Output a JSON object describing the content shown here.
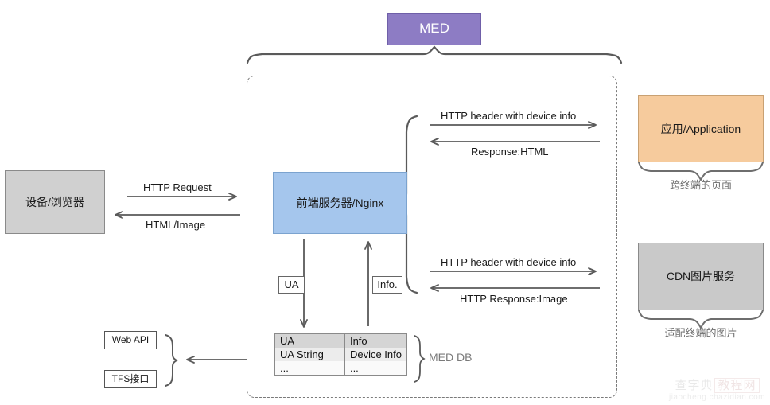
{
  "diagram": {
    "title_box": {
      "label": "MED"
    },
    "device_box": {
      "label": "设备/浏览器"
    },
    "frontend_box": {
      "label": "前端服务器/Nginx"
    },
    "application_box": {
      "label": "应用/Application"
    },
    "application_caption": "跨终端的页面",
    "cdn_box": {
      "label": "CDN图片服务"
    },
    "cdn_caption": "适配终端的图片",
    "web_api_box": {
      "label": "Web API"
    },
    "tfs_box": {
      "label": "TFS接口"
    },
    "ua_tag": {
      "label": "UA"
    },
    "info_tag": {
      "label": "Info."
    },
    "med_db_label": "MED DB",
    "arrows": {
      "http_request": "HTTP Request",
      "html_image": "HTML/Image",
      "header_device_info_top": "HTTP header with device info",
      "response_html": "Response:HTML",
      "header_device_info_bottom": "HTTP header with device info",
      "http_response_image": "HTTP Response:Image"
    },
    "db_table": {
      "header": [
        "UA",
        "Info"
      ],
      "rows": [
        [
          "UA String",
          "Device Info"
        ],
        [
          "...",
          "..."
        ]
      ]
    },
    "colors": {
      "med_purple": "#8d7cc4",
      "device_gray": "#d0d0d0",
      "frontend_blue": "#a5c6ed",
      "application_orange": "#f6cb9d",
      "cdn_gray": "#c9c9c9",
      "arrow_gray": "#5a5a5a",
      "dashed_border": "#7a7a7a"
    }
  },
  "watermark": {
    "line1": "查字典",
    "line1_boxed": "教程网",
    "line2": "jiaocheng.chazidian.com"
  }
}
